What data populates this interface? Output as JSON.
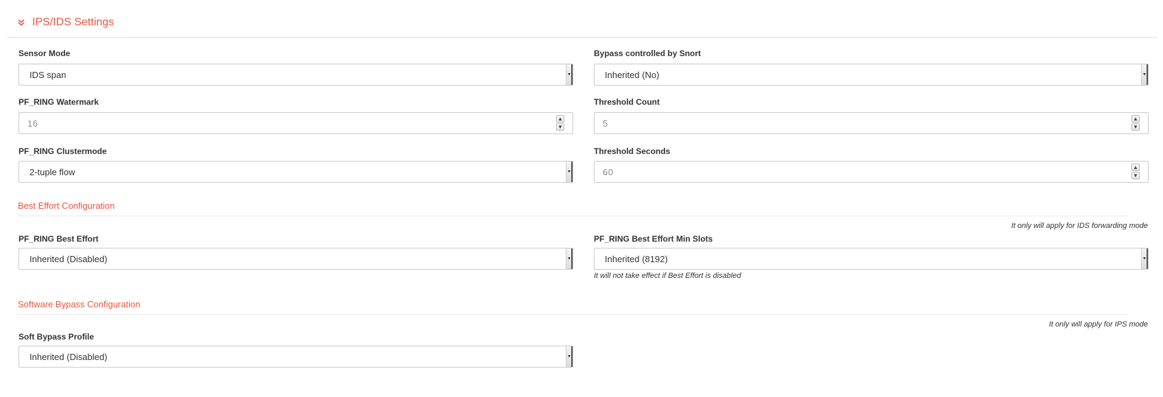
{
  "panel": {
    "title": "IPS/IDS Settings"
  },
  "fields": {
    "sensor_mode": {
      "label": "Sensor Mode",
      "value": "IDS span"
    },
    "bypass_snort": {
      "label": "Bypass controlled by Snort",
      "value": "Inherited (No)"
    },
    "watermark": {
      "label": "PF_RING Watermark",
      "value": "16"
    },
    "threshold_count": {
      "label": "Threshold Count",
      "value": "5"
    },
    "clustermode": {
      "label": "PF_RING Clustermode",
      "value": "2-tuple flow"
    },
    "threshold_seconds": {
      "label": "Threshold Seconds",
      "value": "60"
    },
    "best_effort": {
      "label": "PF_RING Best Effort",
      "value": "Inherited (Disabled)"
    },
    "best_effort_min_slots": {
      "label": "PF_RING Best Effort Min Slots",
      "value": "Inherited (8192)",
      "help": "It will not take effect if Best Effort is disabled"
    },
    "soft_bypass": {
      "label": "Soft Bypass Profile",
      "value": "Inherited (Disabled)"
    }
  },
  "sections": {
    "best_effort": {
      "title": "Best Effort Configuration",
      "note": "It only will apply for IDS forwarding mode"
    },
    "software_bypass": {
      "title": "Software Bypass Configuration",
      "note": "It only will apply for IPS mode"
    }
  },
  "spinner": {
    "up": "▲",
    "down": "▼"
  },
  "colors": {
    "accent": "#e8553e",
    "border": "#c9c9c9",
    "divider": "#e2e2e2"
  }
}
